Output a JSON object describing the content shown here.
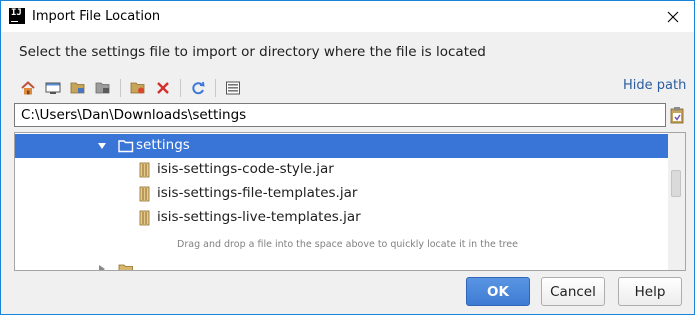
{
  "window": {
    "title": "Import File Location",
    "app_icon_text": "IJ"
  },
  "description": "Select the settings file to import or directory where the file is located",
  "toolbar": {
    "buttons": [
      "home-icon",
      "desktop-icon",
      "project-folder-icon",
      "module-folder-icon",
      "new-folder-icon",
      "delete-icon",
      "refresh-icon",
      "show-hidden-icon"
    ],
    "hide_path_label": "Hide path"
  },
  "path_field": {
    "value": "C:\\Users\\Dan\\Downloads\\settings"
  },
  "tree": {
    "selected_folder": "settings",
    "files": [
      "isis-settings-code-style.jar",
      "isis-settings-file-templates.jar",
      "isis-settings-live-templates.jar"
    ]
  },
  "hint": "Drag and drop a file into the space above to quickly locate it in the tree",
  "buttons": {
    "ok": "OK",
    "cancel": "Cancel",
    "help": "Help"
  },
  "colors": {
    "selection": "#3875d7",
    "link": "#2d5d9f",
    "primary_button": "#4a86da"
  }
}
